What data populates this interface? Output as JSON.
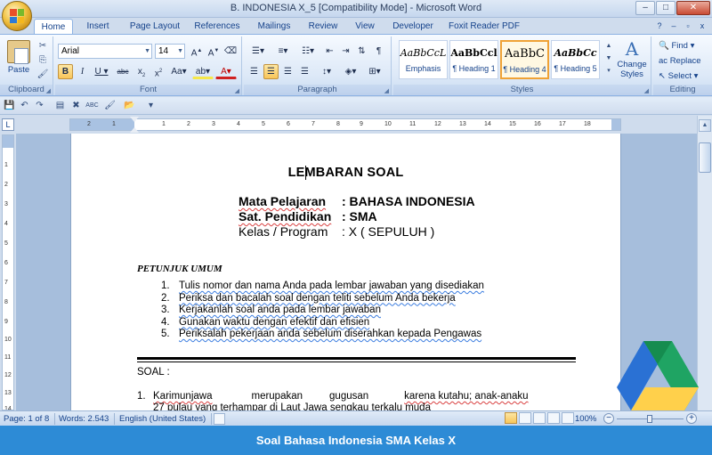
{
  "window": {
    "title": "B. INDONESIA X_5 [Compatibility Mode] - Microsoft Word",
    "minimize": "–",
    "maximize": "□",
    "close": "✕"
  },
  "tabs": [
    "Home",
    "Insert",
    "Page Layout",
    "References",
    "Mailings",
    "Review",
    "View",
    "Developer",
    "Foxit Reader PDF"
  ],
  "ribbon": {
    "clipboard": {
      "label": "Clipboard",
      "paste": "Paste"
    },
    "font": {
      "label": "Font",
      "family": "Arial",
      "size": "14"
    },
    "paragraph": {
      "label": "Paragraph"
    },
    "styles": {
      "label": "Styles",
      "tiles": [
        {
          "sample": "AaBbCcL",
          "name": "Emphasis"
        },
        {
          "sample": "AaBbCcl",
          "name": "¶ Heading 1"
        },
        {
          "sample": "AaBbC",
          "name": "¶ Heading 4"
        },
        {
          "sample": "AaBbCc",
          "name": "¶ Heading 5"
        }
      ],
      "change_styles": "Change Styles"
    },
    "editing": {
      "label": "Editing",
      "find": "Find",
      "replace": "Replace",
      "select": "Select"
    }
  },
  "document": {
    "title": "LEMBARAN SOAL",
    "info": [
      {
        "label": "Mata Pelajaran",
        "value": ": BAHASA INDONESIA"
      },
      {
        "label": "Sat. Pendidikan",
        "value": ": SMA"
      },
      {
        "label": "Kelas / Program",
        "value": ":  X    ( SEPULUH )"
      }
    ],
    "instructions_title": "PETUNJUK UMUM",
    "instructions": [
      {
        "num": "1.",
        "text": "Tulis nomor dan nama Anda pada lembar jawaban yang disediakan"
      },
      {
        "num": "2.",
        "text": "Periksa dan bacalah soal dengan teliti sebelum Anda bekerja"
      },
      {
        "num": "3.",
        "text": "Kerjakanlah soal anda pada lembar jawaban"
      },
      {
        "num": "4.",
        "text": "Gunakan waktu dengan efektif dan efisien"
      },
      {
        "num": "5.",
        "text": "Periksalah pekerjaan anda sebelum diserahkan kepada Pengawas"
      }
    ],
    "soal_label": "SOAL :",
    "question1": {
      "num": "1.",
      "w1": "Karimunjawa",
      "w2": "merupakan",
      "w3": "gugusan",
      "w4": "karena kutahu; anak-anaku",
      "line2": "27  pulau  yang  terhampar  di  Laut  Jawa                sengkau terkalu muda"
    }
  },
  "ruler": {
    "h_ticks": [
      "2",
      "1",
      "1",
      "2",
      "3",
      "4",
      "5",
      "6",
      "7",
      "8",
      "9",
      "10",
      "11",
      "12",
      "13",
      "14",
      "15",
      "16",
      "17",
      "18"
    ],
    "v_ticks": [
      "1",
      "2",
      "3",
      "4",
      "5",
      "6",
      "7",
      "8",
      "9",
      "10",
      "11",
      "12",
      "13",
      "14"
    ]
  },
  "status": {
    "page": "Page: 1 of 8",
    "words": "Words: 2.543",
    "language": "English (United States)",
    "zoom": "100%"
  },
  "caption": "Soal Bahasa Indonesia SMA Kelas X"
}
